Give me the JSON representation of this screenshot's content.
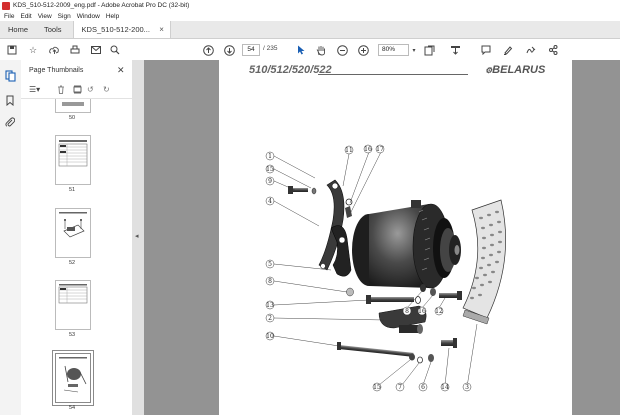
{
  "window": {
    "title": "KDS_510-512-2009_eng.pdf - Adobe Acrobat Pro DC (32-bit)"
  },
  "menu": [
    "File",
    "Edit",
    "View",
    "Sign",
    "Window",
    "Help"
  ],
  "tabs": {
    "home": "Home",
    "tools": "Tools",
    "doc": "KDS_510-512-200..."
  },
  "toolbar": {
    "page_current": "54",
    "page_total": "/ 235",
    "zoom": "80%"
  },
  "panel": {
    "title": "Page Thumbnails",
    "thumbnails": [
      {
        "label": "50"
      },
      {
        "label": "51"
      },
      {
        "label": "52"
      },
      {
        "label": "53"
      },
      {
        "label": "54",
        "selected": true
      }
    ]
  },
  "page": {
    "header_model": "510/512/520/522",
    "header_brand": "BELARUS",
    "callouts": [
      "1",
      "15",
      "9",
      "4",
      "5",
      "8",
      "13",
      "2",
      "10",
      "11",
      "16",
      "17",
      "8",
      "16",
      "12",
      "3",
      "15",
      "7",
      "6",
      "14"
    ]
  }
}
